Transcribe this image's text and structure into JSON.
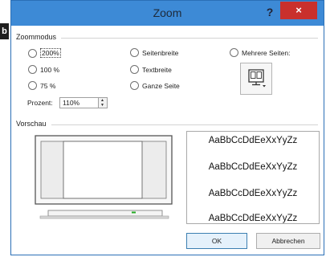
{
  "edge_tab": "b",
  "dialog": {
    "title": "Zoom",
    "help_label": "?",
    "close_label": "×"
  },
  "zoommodus": {
    "label": "Zoommodus",
    "options": [
      {
        "label": "200%",
        "selected": false
      },
      {
        "label": "100 %",
        "selected": false
      },
      {
        "label": "75 %",
        "selected": false
      },
      {
        "label": "Seitenbreite",
        "selected": false
      },
      {
        "label": "Textbreite",
        "selected": false
      },
      {
        "label": "Ganze Seite",
        "selected": false
      },
      {
        "label": "Mehrere Seiten:",
        "selected": false
      }
    ],
    "prozent_label": "Prozent:",
    "prozent_value": "110%"
  },
  "vorschau": {
    "label": "Vorschau",
    "sample_text": [
      "AaBbCcDdEeXxYyZz",
      "AaBbCcDdEeXxYyZz",
      "AaBbCcDdEeXxYyZz",
      "AaBbCcDdEeXxYyZz"
    ]
  },
  "buttons": {
    "ok": "OK",
    "cancel": "Abbrechen"
  },
  "colors": {
    "titlebar": "#3d8ad6",
    "close": "#c9302c",
    "monitor_stand_accent": "#22aa22"
  },
  "icons": {
    "multi_pages": "monitor-pages-icon",
    "spin": "spinner-arrows-icon"
  }
}
